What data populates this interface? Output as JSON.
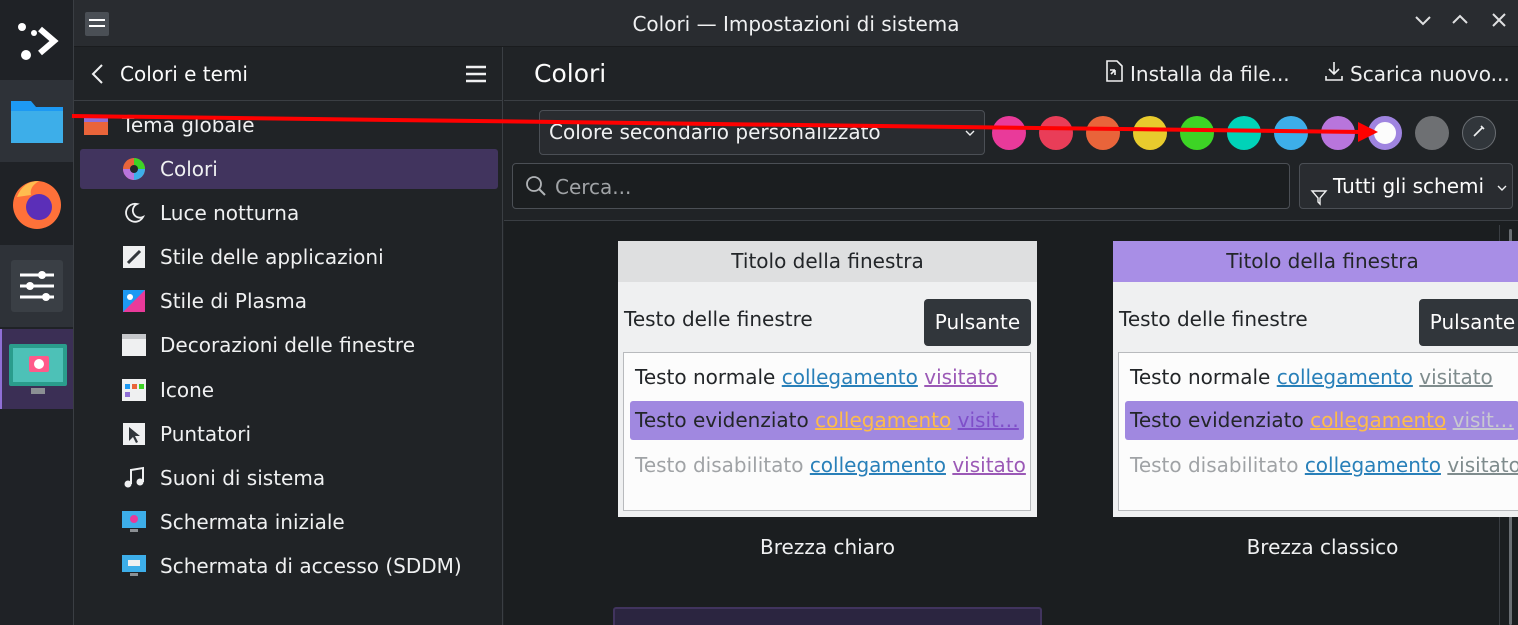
{
  "window": {
    "title": "Colori — Impostazioni di sistema"
  },
  "sidebar": {
    "back_label": "Colori e temi",
    "items": [
      {
        "label": "Tema globale"
      },
      {
        "label": "Colori"
      },
      {
        "label": "Luce notturna"
      },
      {
        "label": "Stile delle applicazioni"
      },
      {
        "label": "Stile di Plasma"
      },
      {
        "label": "Decorazioni delle finestre"
      },
      {
        "label": "Icone"
      },
      {
        "label": "Puntatori"
      },
      {
        "label": "Suoni di sistema"
      },
      {
        "label": "Schermata iniziale"
      },
      {
        "label": "Schermata di accesso (SDDM)"
      }
    ],
    "selected": "Colori"
  },
  "main": {
    "title": "Colori",
    "install_label": "Installa da file...",
    "download_label": "Scarica nuovo...",
    "accent_combo": "Colore secondario personalizzato",
    "swatches": [
      "#e93a9a",
      "#e93d58",
      "#e9643a",
      "#e8cb2d",
      "#3dd425",
      "#00d3b8",
      "#3daee9",
      "#b875dc",
      "#9f84e0",
      "#6e7073"
    ],
    "selected_swatch": 8,
    "search_placeholder": "Cerca...",
    "filter_label": "Tutti gli schemi"
  },
  "schemes": [
    {
      "name": "Brezza chiaro",
      "title_bar": "Titolo della finestra",
      "title_color": "#dedfe0",
      "window_text": "Testo delle finestre",
      "button": "Pulsante",
      "normal": "Testo normale",
      "highlighted": "Testo evidenziato",
      "disabled": "Testo disabilitato",
      "link": "collegamento",
      "visited": "visitato",
      "visited_truncated": "visit…"
    },
    {
      "name": "Brezza classico",
      "title_bar": "Titolo della finestra",
      "title_color": "#a88ee6",
      "window_text": "Testo delle finestre",
      "button": "Pulsante",
      "normal": "Testo normale",
      "highlighted": "Testo evidenziato",
      "disabled": "Testo disabilitato",
      "link": "collegamento",
      "visited": "visitato",
      "visited_truncated": "visit…"
    }
  ],
  "annotation": {
    "arrow_color": "#ff0000"
  }
}
